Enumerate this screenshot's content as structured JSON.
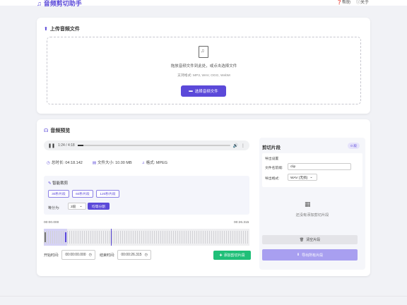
{
  "app": {
    "title": "音频剪切助手",
    "nav": [
      "帮助",
      "关于"
    ]
  },
  "upload": {
    "title": "上传音频文件",
    "hint": "拖放音频文件到此处，或点击选择文件",
    "formats": "支持格式: MP3, WAV, OGG, WebM",
    "button": "选择音频文件"
  },
  "preview": {
    "title": "音频预览",
    "player": {
      "current": "1:24",
      "duration": "4:18",
      "progress": 0.04
    },
    "info": {
      "duration": "总时长: 04:18.142",
      "size": "文件大小: 10.00 MB",
      "format": "格式: MPEG"
    },
    "smart": {
      "title": "智能裁剪",
      "presets": [
        "30秒片段",
        "60秒片段",
        "120秒片段"
      ],
      "equal_label": "等分为:",
      "equal_value": "2段",
      "equal_button": "均等分割"
    },
    "wave": {
      "start_label": "00:00.000",
      "end_label": "00:26.315"
    },
    "range": {
      "start_label": "开始时间:",
      "start_value": "00:00:00.000",
      "end_label": "结束时间:",
      "end_value": "00:00:26.315"
    },
    "add_button": "添加剪切片段"
  },
  "segments": {
    "title": "剪切片段",
    "count": "0 段",
    "export_settings": "导出设置",
    "prefix_label": "文件名前缀:",
    "prefix_value": "clip",
    "format_label": "导出格式:",
    "format_value": "WAV (无损)",
    "empty": "还没有添加剪切片段",
    "clear_button": "清空片段",
    "export_button": "导出所有片段"
  },
  "colors": {
    "accent": "#5b49d9",
    "success": "#1fbf78",
    "disabled": "#a89ff0"
  }
}
